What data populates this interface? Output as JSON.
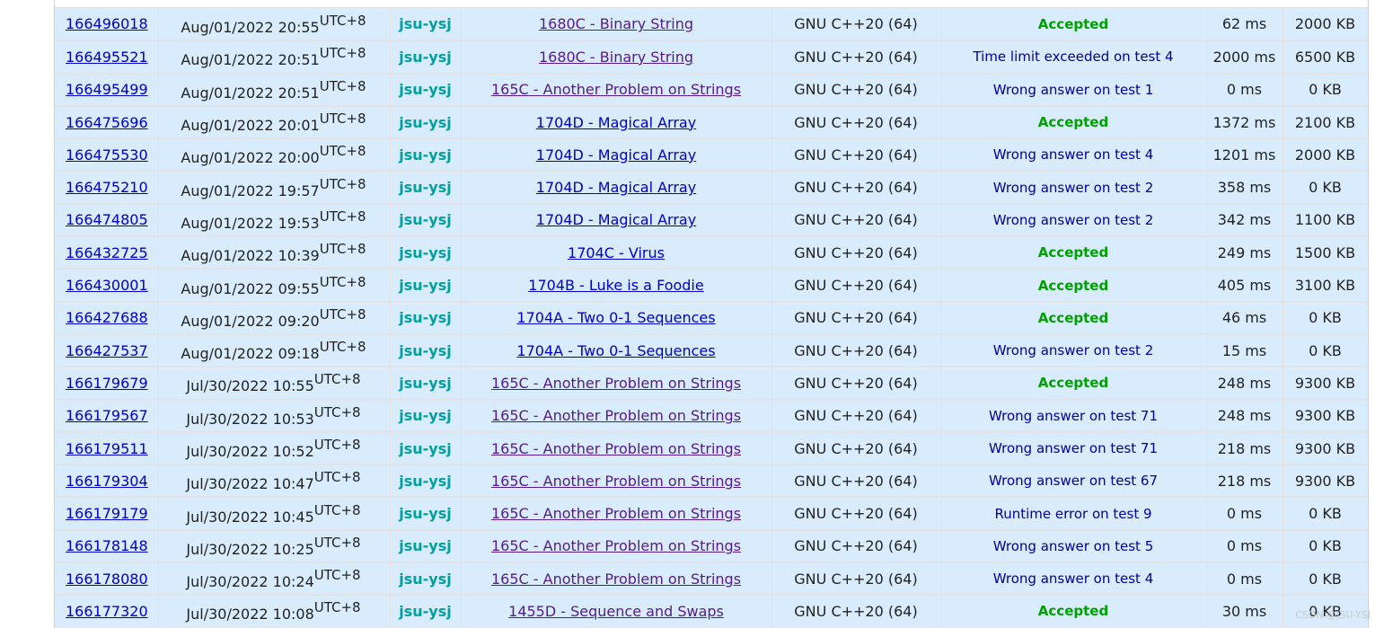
{
  "watermark": "CSDN @JSU-YSJ",
  "colors": {
    "row_bg": "#d9ecfd",
    "accepted": "#00a000",
    "verdict": "#0000a0",
    "handle": "#00a0a0",
    "link": "#0000cc",
    "visited_link": "#551a8b"
  },
  "rows": [
    {
      "id": "166496018",
      "date": "Aug/01/2022 20:55",
      "tz": "UTC+8",
      "user": "jsu-ysj",
      "problem": "1680C - Binary String",
      "visited": true,
      "lang": "GNU C++20 (64)",
      "verdict": "Accepted",
      "accepted": true,
      "time": "62 ms",
      "memory": "2000 KB"
    },
    {
      "id": "166495521",
      "date": "Aug/01/2022 20:51",
      "tz": "UTC+8",
      "user": "jsu-ysj",
      "problem": "1680C - Binary String",
      "visited": true,
      "lang": "GNU C++20 (64)",
      "verdict": "Time limit exceeded on test 4",
      "accepted": false,
      "time": "2000 ms",
      "memory": "6500 KB"
    },
    {
      "id": "166495499",
      "date": "Aug/01/2022 20:51",
      "tz": "UTC+8",
      "user": "jsu-ysj",
      "problem": "165C - Another Problem on Strings",
      "visited": true,
      "lang": "GNU C++20 (64)",
      "verdict": "Wrong answer on test 1",
      "accepted": false,
      "time": "0 ms",
      "memory": "0 KB"
    },
    {
      "id": "166475696",
      "date": "Aug/01/2022 20:01",
      "tz": "UTC+8",
      "user": "jsu-ysj",
      "problem": "1704D - Magical Array",
      "visited": false,
      "lang": "GNU C++20 (64)",
      "verdict": "Accepted",
      "accepted": true,
      "time": "1372 ms",
      "memory": "2100 KB"
    },
    {
      "id": "166475530",
      "date": "Aug/01/2022 20:00",
      "tz": "UTC+8",
      "user": "jsu-ysj",
      "problem": "1704D - Magical Array",
      "visited": false,
      "lang": "GNU C++20 (64)",
      "verdict": "Wrong answer on test 4",
      "accepted": false,
      "time": "1201 ms",
      "memory": "2000 KB"
    },
    {
      "id": "166475210",
      "date": "Aug/01/2022 19:57",
      "tz": "UTC+8",
      "user": "jsu-ysj",
      "problem": "1704D - Magical Array",
      "visited": false,
      "lang": "GNU C++20 (64)",
      "verdict": "Wrong answer on test 2",
      "accepted": false,
      "time": "358 ms",
      "memory": "0 KB"
    },
    {
      "id": "166474805",
      "date": "Aug/01/2022 19:53",
      "tz": "UTC+8",
      "user": "jsu-ysj",
      "problem": "1704D - Magical Array",
      "visited": false,
      "lang": "GNU C++20 (64)",
      "verdict": "Wrong answer on test 2",
      "accepted": false,
      "time": "342 ms",
      "memory": "1100 KB"
    },
    {
      "id": "166432725",
      "date": "Aug/01/2022 10:39",
      "tz": "UTC+8",
      "user": "jsu-ysj",
      "problem": "1704C - Virus",
      "visited": false,
      "lang": "GNU C++20 (64)",
      "verdict": "Accepted",
      "accepted": true,
      "time": "249 ms",
      "memory": "1500 KB"
    },
    {
      "id": "166430001",
      "date": "Aug/01/2022 09:55",
      "tz": "UTC+8",
      "user": "jsu-ysj",
      "problem": "1704B - Luke is a Foodie",
      "visited": false,
      "lang": "GNU C++20 (64)",
      "verdict": "Accepted",
      "accepted": true,
      "time": "405 ms",
      "memory": "3100 KB"
    },
    {
      "id": "166427688",
      "date": "Aug/01/2022 09:20",
      "tz": "UTC+8",
      "user": "jsu-ysj",
      "problem": "1704A - Two 0-1 Sequences",
      "visited": false,
      "lang": "GNU C++20 (64)",
      "verdict": "Accepted",
      "accepted": true,
      "time": "46 ms",
      "memory": "0 KB"
    },
    {
      "id": "166427537",
      "date": "Aug/01/2022 09:18",
      "tz": "UTC+8",
      "user": "jsu-ysj",
      "problem": "1704A - Two 0-1 Sequences",
      "visited": false,
      "lang": "GNU C++20 (64)",
      "verdict": "Wrong answer on test 2",
      "accepted": false,
      "time": "15 ms",
      "memory": "0 KB"
    },
    {
      "id": "166179679",
      "date": "Jul/30/2022 10:55",
      "tz": "UTC+8",
      "user": "jsu-ysj",
      "problem": "165C - Another Problem on Strings",
      "visited": true,
      "lang": "GNU C++20 (64)",
      "verdict": "Accepted",
      "accepted": true,
      "time": "248 ms",
      "memory": "9300 KB"
    },
    {
      "id": "166179567",
      "date": "Jul/30/2022 10:53",
      "tz": "UTC+8",
      "user": "jsu-ysj",
      "problem": "165C - Another Problem on Strings",
      "visited": true,
      "lang": "GNU C++20 (64)",
      "verdict": "Wrong answer on test 71",
      "accepted": false,
      "time": "248 ms",
      "memory": "9300 KB"
    },
    {
      "id": "166179511",
      "date": "Jul/30/2022 10:52",
      "tz": "UTC+8",
      "user": "jsu-ysj",
      "problem": "165C - Another Problem on Strings",
      "visited": true,
      "lang": "GNU C++20 (64)",
      "verdict": "Wrong answer on test 71",
      "accepted": false,
      "time": "218 ms",
      "memory": "9300 KB"
    },
    {
      "id": "166179304",
      "date": "Jul/30/2022 10:47",
      "tz": "UTC+8",
      "user": "jsu-ysj",
      "problem": "165C - Another Problem on Strings",
      "visited": true,
      "lang": "GNU C++20 (64)",
      "verdict": "Wrong answer on test 67",
      "accepted": false,
      "time": "218 ms",
      "memory": "9300 KB"
    },
    {
      "id": "166179179",
      "date": "Jul/30/2022 10:45",
      "tz": "UTC+8",
      "user": "jsu-ysj",
      "problem": "165C - Another Problem on Strings",
      "visited": true,
      "lang": "GNU C++20 (64)",
      "verdict": "Runtime error on test 9",
      "accepted": false,
      "time": "0 ms",
      "memory": "0 KB"
    },
    {
      "id": "166178148",
      "date": "Jul/30/2022 10:25",
      "tz": "UTC+8",
      "user": "jsu-ysj",
      "problem": "165C - Another Problem on Strings",
      "visited": true,
      "lang": "GNU C++20 (64)",
      "verdict": "Wrong answer on test 5",
      "accepted": false,
      "time": "0 ms",
      "memory": "0 KB"
    },
    {
      "id": "166178080",
      "date": "Jul/30/2022 10:24",
      "tz": "UTC+8",
      "user": "jsu-ysj",
      "problem": "165C - Another Problem on Strings",
      "visited": true,
      "lang": "GNU C++20 (64)",
      "verdict": "Wrong answer on test 4",
      "accepted": false,
      "time": "0 ms",
      "memory": "0 KB"
    },
    {
      "id": "166177320",
      "date": "Jul/30/2022 10:08",
      "tz": "UTC+8",
      "user": "jsu-ysj",
      "problem": "1455D - Sequence and Swaps",
      "visited": true,
      "lang": "GNU C++20 (64)",
      "verdict": "Accepted",
      "accepted": true,
      "time": "30 ms",
      "memory": "0 KB"
    }
  ]
}
